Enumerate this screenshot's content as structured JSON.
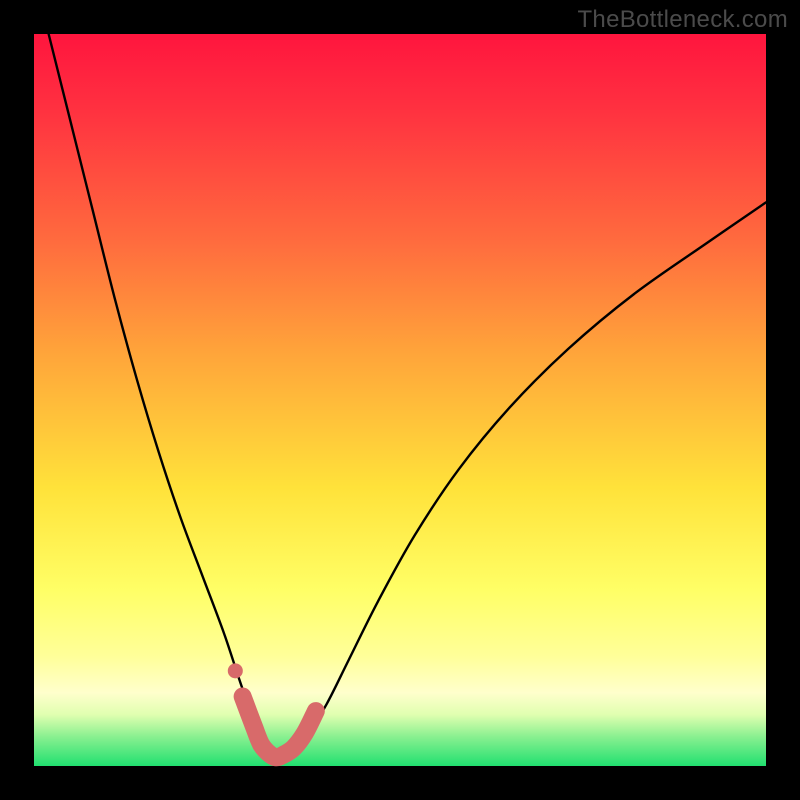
{
  "watermark": "TheBottleneck.com",
  "colors": {
    "frame": "#000000",
    "curve": "#000000",
    "marker": "#d86a6a"
  },
  "chart_data": {
    "type": "line",
    "title": "",
    "xlabel": "",
    "ylabel": "",
    "xlim": [
      0,
      1
    ],
    "ylim": [
      0,
      1
    ],
    "series": [
      {
        "name": "bottleneck-curve",
        "x": [
          0.02,
          0.05,
          0.08,
          0.11,
          0.14,
          0.17,
          0.2,
          0.23,
          0.26,
          0.285,
          0.305,
          0.32,
          0.33,
          0.34,
          0.355,
          0.375,
          0.4,
          0.43,
          0.47,
          0.52,
          0.58,
          0.65,
          0.73,
          0.82,
          0.92,
          1.0
        ],
        "y": [
          1.0,
          0.88,
          0.76,
          0.64,
          0.53,
          0.43,
          0.34,
          0.26,
          0.18,
          0.105,
          0.055,
          0.025,
          0.012,
          0.012,
          0.022,
          0.045,
          0.085,
          0.145,
          0.225,
          0.315,
          0.405,
          0.49,
          0.57,
          0.645,
          0.715,
          0.77
        ]
      }
    ],
    "markers": {
      "name": "bottom-arc",
      "x": [
        0.285,
        0.3,
        0.31,
        0.32,
        0.33,
        0.34,
        0.355,
        0.37,
        0.385
      ],
      "y": [
        0.095,
        0.055,
        0.03,
        0.018,
        0.012,
        0.015,
        0.025,
        0.045,
        0.075
      ]
    },
    "extra_marker": {
      "x": 0.275,
      "y": 0.13
    }
  }
}
